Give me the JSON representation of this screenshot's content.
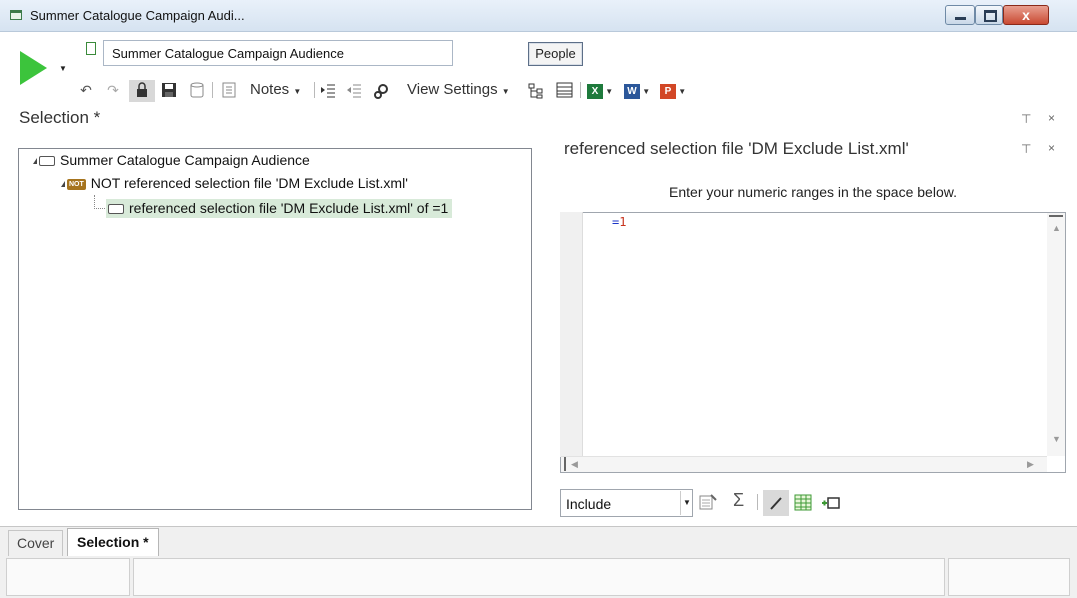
{
  "window": {
    "title": "Summer Catalogue Campaign Audi...",
    "close_glyph": "x"
  },
  "toolbar": {
    "selection_name": "Summer Catalogue Campaign Audience",
    "people_label": "People",
    "notes_label": "Notes",
    "view_settings_label": "View Settings",
    "excel_label": "X",
    "word_label": "W",
    "powerpoint_label": "P"
  },
  "selection": {
    "title": "Selection *"
  },
  "tree": {
    "root": "Summer Catalogue Campaign Audience",
    "not_badge": "NOT",
    "not_node": "NOT referenced selection file 'DM Exclude List.xml'",
    "child_node": "referenced selection file 'DM Exclude List.xml' of =1"
  },
  "detail": {
    "title": "referenced selection file 'DM Exclude List.xml'",
    "hint": "Enter your numeric ranges in the space below.",
    "editor_op": "=",
    "editor_value": "1",
    "mode_value": "Include"
  },
  "tabs": [
    {
      "label": "Cover",
      "active": false
    },
    {
      "label": "Selection *",
      "active": true
    }
  ],
  "icons": [
    "run-icon",
    "undo-icon",
    "redo-icon",
    "lock-icon",
    "save-icon",
    "database-icon",
    "notes-icon",
    "indent-icon",
    "outdent-icon",
    "settings-icon",
    "tree-icon",
    "grid-icon",
    "excel-icon",
    "word-icon",
    "powerpoint-icon",
    "sigma-icon"
  ]
}
